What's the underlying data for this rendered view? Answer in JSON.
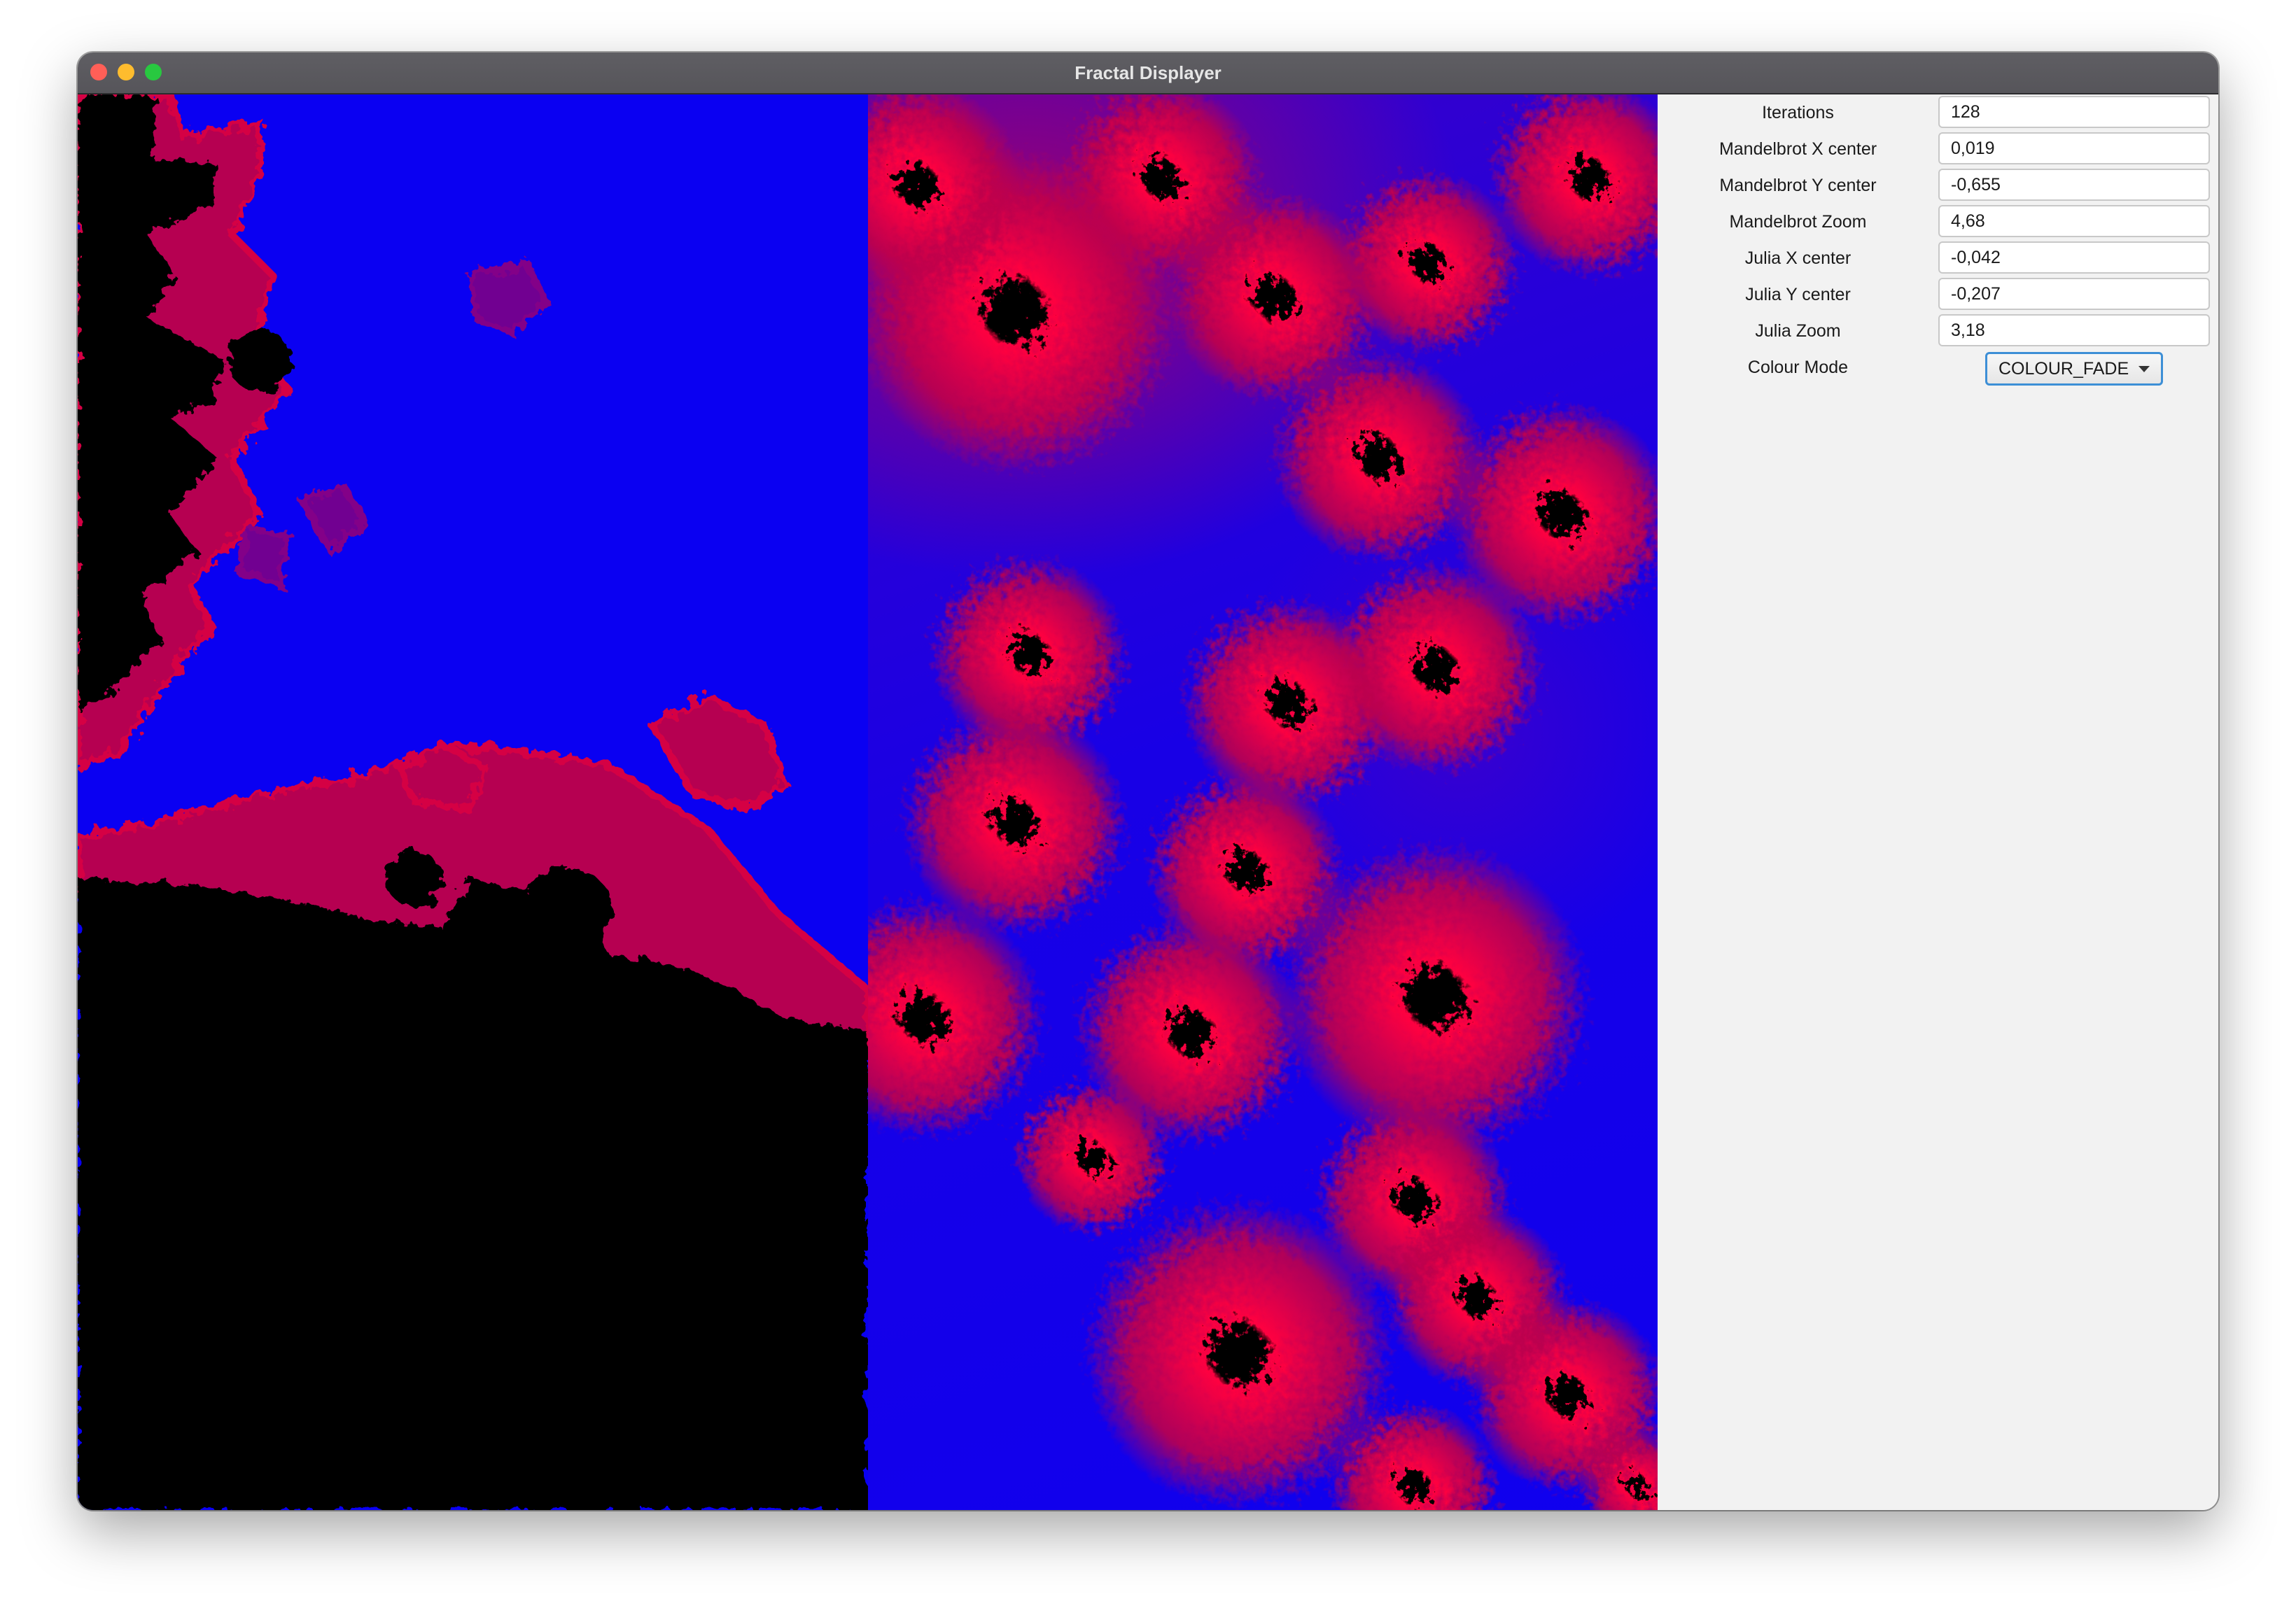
{
  "window": {
    "title": "Fractal Displayer"
  },
  "controls": {
    "iterations": {
      "label": "Iterations",
      "value": "128"
    },
    "mandelbrot_x": {
      "label": "Mandelbrot X center",
      "value": "0,019"
    },
    "mandelbrot_y": {
      "label": "Mandelbrot Y center",
      "value": "-0,655"
    },
    "mandelbrot_zoom": {
      "label": "Mandelbrot Zoom",
      "value": "4,68"
    },
    "julia_x": {
      "label": "Julia X center",
      "value": "-0,042"
    },
    "julia_y": {
      "label": "Julia Y center",
      "value": "-0,207"
    },
    "julia_zoom": {
      "label": "Julia Zoom",
      "value": "3,18"
    },
    "colour_mode": {
      "label": "Colour Mode",
      "value": "COLOUR_FADE"
    }
  },
  "colors": {
    "escape_background": "#0a00f2",
    "boundary_red": "#e0003a",
    "set_interior": "#000000",
    "focus_border": "#3d8fd6"
  },
  "icons": {
    "close": "close-traffic-light-icon",
    "minimize": "minimize-traffic-light-icon",
    "maximize": "maximize-traffic-light-icon",
    "dropdown": "chevron-down-icon"
  }
}
